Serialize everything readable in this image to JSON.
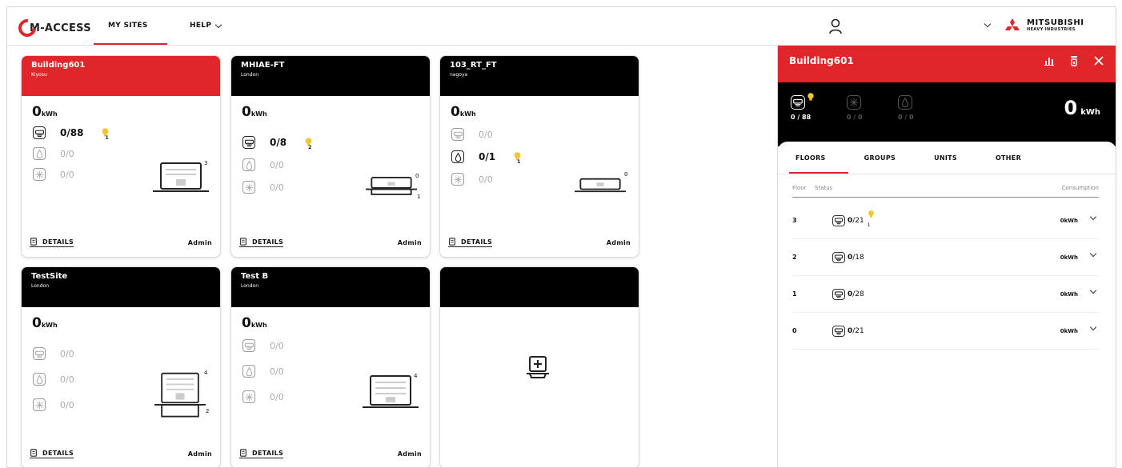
{
  "nav": {
    "logo_text": "M-ACCESS",
    "my_sites": "MY SITES",
    "help": "HELP",
    "brand_line1": "MITSUBISHI",
    "brand_line2": "HEAVY INDUSTRIES"
  },
  "colors": {
    "accent": "#e0262a",
    "header_dark": "#000000",
    "bulb": "#f3c531"
  },
  "sites": [
    {
      "name": "Building601",
      "location": "Kiyosu",
      "energy": "0",
      "unit": "kWh",
      "ac": "0/88",
      "ac_alert": "1",
      "water": "0/0",
      "vent": "0/0",
      "controllers_top": "3",
      "controllers_bottom": "",
      "details": "DETAILS",
      "role": "Admin"
    },
    {
      "name": "MHIAE-FT",
      "location": "London",
      "energy": "0",
      "unit": "kWh",
      "ac": "0/8",
      "ac_alert": "2",
      "water": "0/0",
      "vent": "0/0",
      "controllers_top": "0",
      "controllers_bottom": "1",
      "details": "DETAILS",
      "role": "Admin"
    },
    {
      "name": "103_RT_FT",
      "location": "nagoya",
      "energy": "0",
      "unit": "kWh",
      "ac": "0/0",
      "water": "0/1",
      "water_alert": "1",
      "vent": "0/0",
      "controllers_top": "0",
      "controllers_bottom": "",
      "details": "DETAILS",
      "role": "Admin"
    },
    {
      "name": "TestSite",
      "location": "London",
      "energy": "0",
      "unit": "kWh",
      "ac": "0/0",
      "water": "0/0",
      "vent": "0/0",
      "controllers_top": "4",
      "controllers_bottom": "2",
      "details": "DETAILS",
      "role": "Admin"
    },
    {
      "name": "Test B",
      "location": "London",
      "energy": "0",
      "unit": "kWh",
      "ac": "0/0",
      "water": "0/0",
      "vent": "0/0",
      "controllers_top": "4",
      "controllers_bottom": "",
      "details": "DETAILS",
      "role": "Admin"
    }
  ],
  "panel": {
    "title": "Building601",
    "ac": "0 / 88",
    "vent": "0 / 0",
    "water": "0 / 0",
    "energy": "0",
    "unit": "kWh",
    "tabs": [
      "FLOORS",
      "GROUPS",
      "UNITS",
      "OTHER"
    ],
    "headers": {
      "floor": "Floor",
      "status": "Status",
      "consumption": "Consumption"
    },
    "floors": [
      {
        "floor": "3",
        "value": "0",
        "total": "/21",
        "alert": "1",
        "consumption": "0kWh"
      },
      {
        "floor": "2",
        "value": "0",
        "total": "/18",
        "consumption": "0kWh"
      },
      {
        "floor": "1",
        "value": "0",
        "total": "/28",
        "consumption": "0kWh"
      },
      {
        "floor": "0",
        "value": "0",
        "total": "/21",
        "consumption": "0kWh"
      }
    ]
  }
}
